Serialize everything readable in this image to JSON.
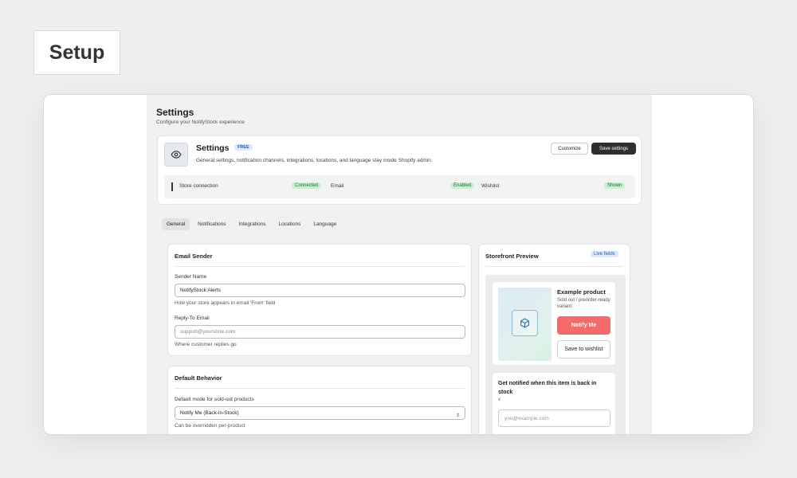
{
  "setup_label": "Setup",
  "page": {
    "title": "Settings",
    "subtitle": "Configure your NotifyStock experience"
  },
  "hero": {
    "icon": "eye-icon",
    "title": "Settings",
    "badge": "FREE",
    "description": "General settings, notification channels, integrations, locations, and language stay inside Shopify admin.",
    "customize_label": "Customize",
    "save_label": "Save settings"
  },
  "status": [
    {
      "label": "Store connection",
      "value": "Connected"
    },
    {
      "label": "Email",
      "value": "Enabled"
    },
    {
      "label": "Wishlist",
      "value": "Shown"
    }
  ],
  "tabs": [
    "General",
    "Notifications",
    "Integrations",
    "Locations",
    "Language"
  ],
  "active_tab": "General",
  "email_sender": {
    "title": "Email Sender",
    "sender_name_label": "Sender Name",
    "sender_name_value": "NotifyStock Alerts",
    "sender_name_help": "How your store appears in email 'From' field",
    "reply_to_label": "Reply-To Email",
    "reply_to_placeholder": "support@yourstore.com",
    "reply_to_help": "Where customer replies go"
  },
  "default_behavior": {
    "title": "Default Behavior",
    "mode_label": "Default mode for sold-out products",
    "mode_value": "Notify Me (Back-in-Stock)",
    "mode_help": "Can be overridden per-product"
  },
  "preview": {
    "title": "Storefront Preview",
    "badge": "Live fields",
    "product_name": "Example product",
    "product_desc": "Sold out / preorder-ready variant",
    "product_icon": "cube-icon",
    "notify_label": "Notify Me",
    "wishlist_label": "Save to wishlist",
    "form_title": "Get notified when this item is back in stock",
    "form_close": "x",
    "email_placeholder": "you@example.com"
  },
  "colors": {
    "accent_dark": "#2e2e2e",
    "notify_button": "#f36b6b",
    "success_pill": "#c9f0d3",
    "info_badge": "#dbe9fb"
  }
}
